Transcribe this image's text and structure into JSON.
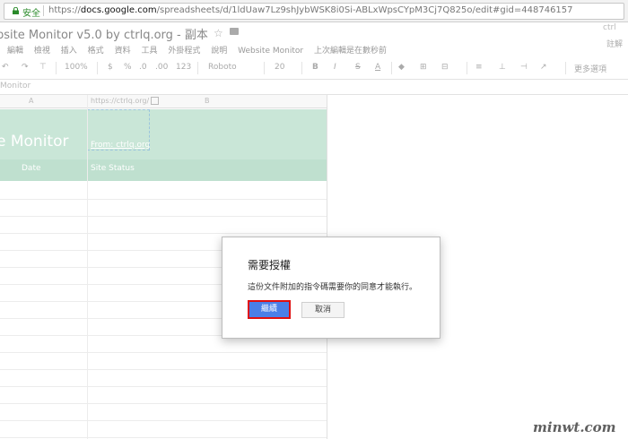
{
  "browser": {
    "secure_label": "安全",
    "url_scheme": "https://",
    "url_host": "docs.google.com",
    "url_path": "/spreadsheets/d/1ldUaw7Lz9shJybWSK8i0Si-ABLxWpsCYpM3Cj7Q825o/edit#gid=448746157"
  },
  "doc": {
    "title": "bsite Monitor v5.0 by ctrlq.org - 副本",
    "account_hint": "ctrl",
    "share_hint": "註解"
  },
  "menu": [
    "編輯",
    "檢視",
    "插入",
    "格式",
    "資料",
    "工具",
    "外掛程式",
    "說明",
    "Website Monitor",
    "上次編輯是在數秒前"
  ],
  "toolbar": {
    "zoom": "100%",
    "currency": "$",
    "percent": "%",
    "decimals_less": ".0",
    "decimals_more": ".00",
    "number_format": "123",
    "font": "Roboto",
    "font_size": "20",
    "bold": "B",
    "italic": "I",
    "strike": "S",
    "text_color": "A",
    "more": "更多選項"
  },
  "formula_bar": {
    "name": "Monitor"
  },
  "sheet": {
    "col_a": "A",
    "col_b": "B",
    "link_cell": "https://ctrlq.org/",
    "title_cell": "e Monitor",
    "from_cell": "From: ctrlq.org",
    "header_date": "Date",
    "header_status": "Site Status"
  },
  "dialog": {
    "title": "需要授權",
    "message": "這份文件附加的指令碼需要你的同意才能執行。",
    "continue_label": "繼續",
    "cancel_label": "取消"
  },
  "watermark": {
    "text": "minwt.com"
  },
  "colors": {
    "accent_green": "#c9e6d7",
    "button_blue": "#4a7fe8",
    "highlight_red": "#e01010"
  }
}
